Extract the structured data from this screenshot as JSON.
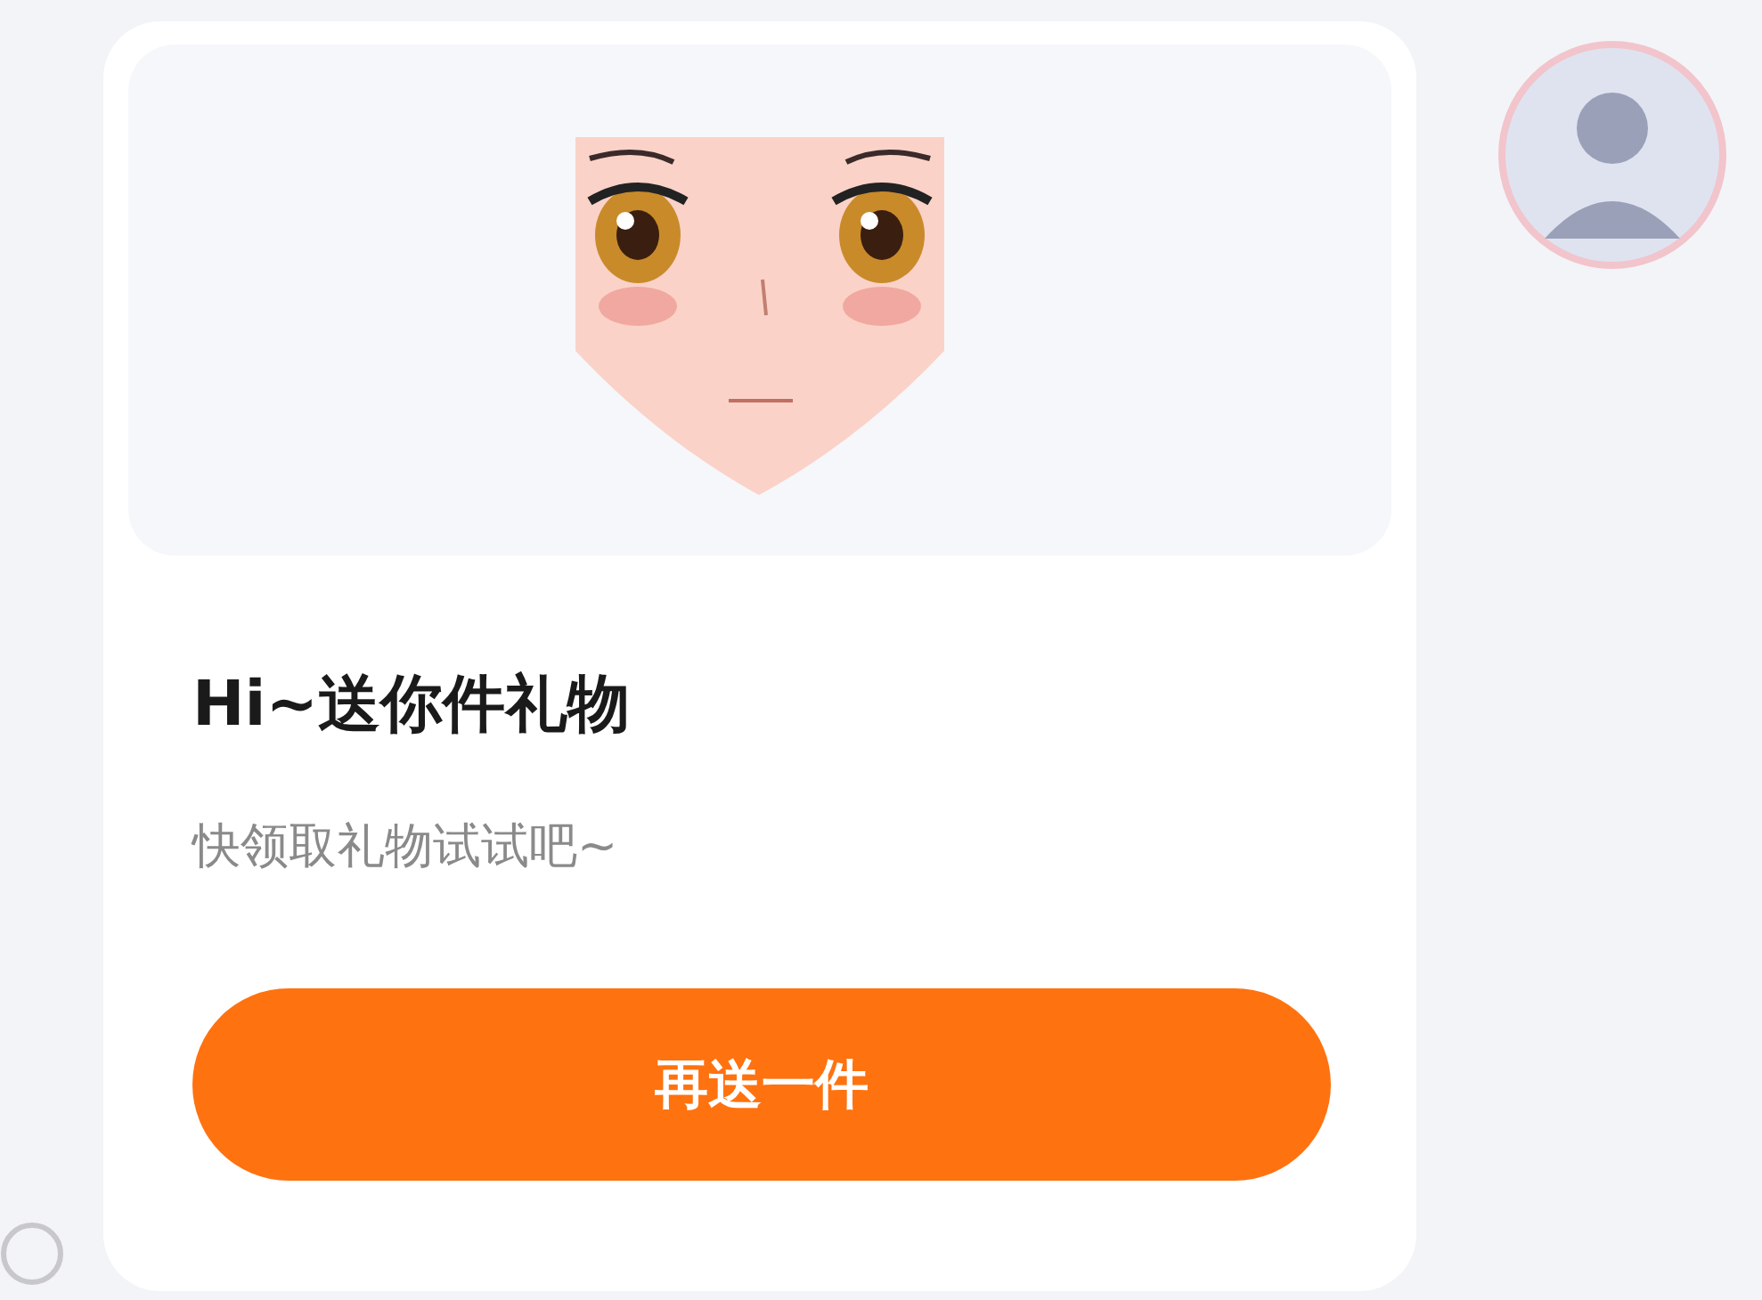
{
  "card": {
    "title": "Hi~送你件礼物",
    "subtitle": "快领取礼物试试吧~",
    "button": "再送一件"
  }
}
